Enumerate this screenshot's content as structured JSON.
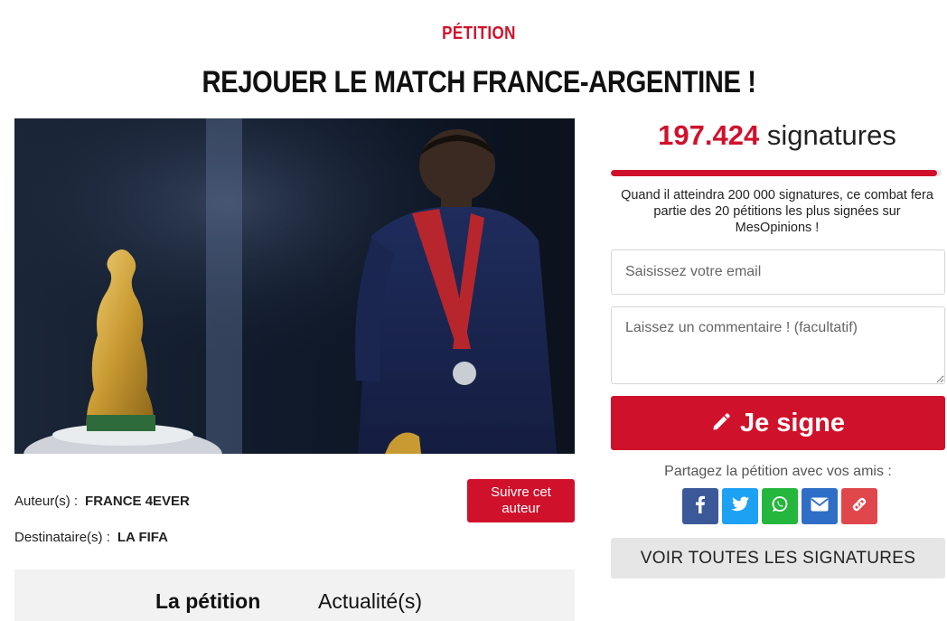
{
  "header": {
    "kicker": "PÉTITION",
    "title": "REJOUER LE MATCH FRANCE-ARGENTINE !"
  },
  "petition": {
    "author_label": "Auteur(s) :",
    "author_value": "FRANCE 4EVER",
    "recipient_label": "Destinataire(s) :",
    "recipient_value": "LA FIFA",
    "follow_label": "Suivre cet auteur",
    "tabs": [
      {
        "label": "La pétition",
        "active": true
      },
      {
        "label": "Actualité(s)",
        "active": false
      }
    ]
  },
  "sidebar": {
    "count_value": "197.424",
    "count_suffix": "signatures",
    "progress_fraction": 0.987,
    "goal_text": "Quand il atteindra 200 000 signatures, ce combat fera partie des 20 pétitions les plus signées sur MesOpinions !",
    "email_placeholder": "Saisissez votre email",
    "comment_placeholder": "Laissez un commentaire ! (facultatif)",
    "sign_label": "Je signe",
    "share_text": "Partagez la pétition avec vos amis :",
    "share_buttons": [
      {
        "icon": "facebook-icon",
        "color": "#3b5998"
      },
      {
        "icon": "twitter-icon",
        "color": "#1da1f2"
      },
      {
        "icon": "whatsapp-icon",
        "color": "#25b63d"
      },
      {
        "icon": "mail-icon",
        "color": "#2f6ec6"
      },
      {
        "icon": "link-icon",
        "color": "#e0474c"
      }
    ],
    "all_signatures_label": "VOIR TOUTES LES SIGNATURES"
  },
  "colors": {
    "accent": "#d0112b",
    "tab_bg": "#f2f2f2",
    "secondary_button_bg": "#e6e6e6"
  }
}
